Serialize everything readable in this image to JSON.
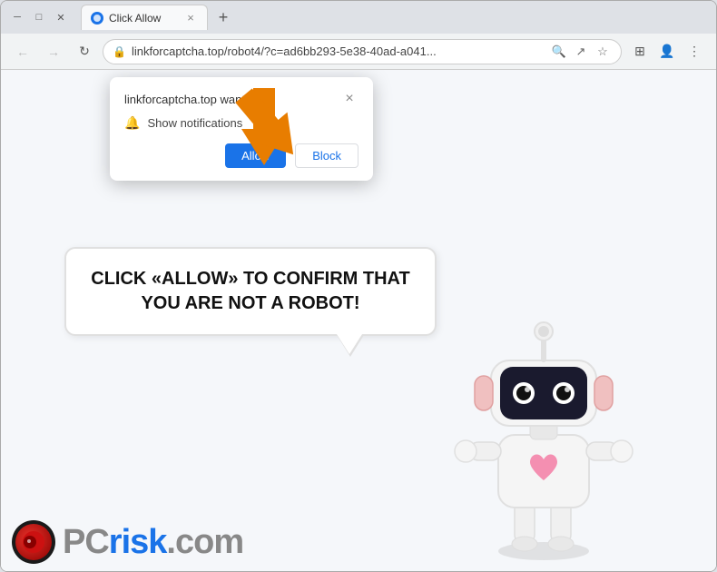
{
  "window": {
    "title": "Click Allow",
    "favicon": "●",
    "tab_close": "×",
    "new_tab": "+"
  },
  "nav": {
    "back": "←",
    "forward": "→",
    "refresh": "↻",
    "address": "linkforcaptcha.top/robot4/?c=ad6bb293-5e38-40ad-a041...",
    "lock": "🔒",
    "search_icon": "🔍",
    "share_icon": "↗",
    "star_icon": "☆",
    "sidebar_icon": "⊞",
    "profile_icon": "👤",
    "menu_icon": "⋮"
  },
  "popup": {
    "site_text": "linkforcaptcha.top wants to",
    "close": "×",
    "bell": "🔔",
    "notification_label": "Show notifications",
    "allow_label": "Allow",
    "block_label": "Block"
  },
  "bubble": {
    "text": "CLICK «ALLOW» TO CONFIRM THAT YOU ARE NOT A ROBOT!"
  },
  "pcrisk": {
    "text_grey": "PC",
    "text_blue": "risk",
    "suffix": ".com"
  },
  "colors": {
    "allow_btn_bg": "#1a73e8",
    "block_btn_border": "#dadce0",
    "bubble_border": "#e0e0e0",
    "text_dark": "#111111"
  }
}
